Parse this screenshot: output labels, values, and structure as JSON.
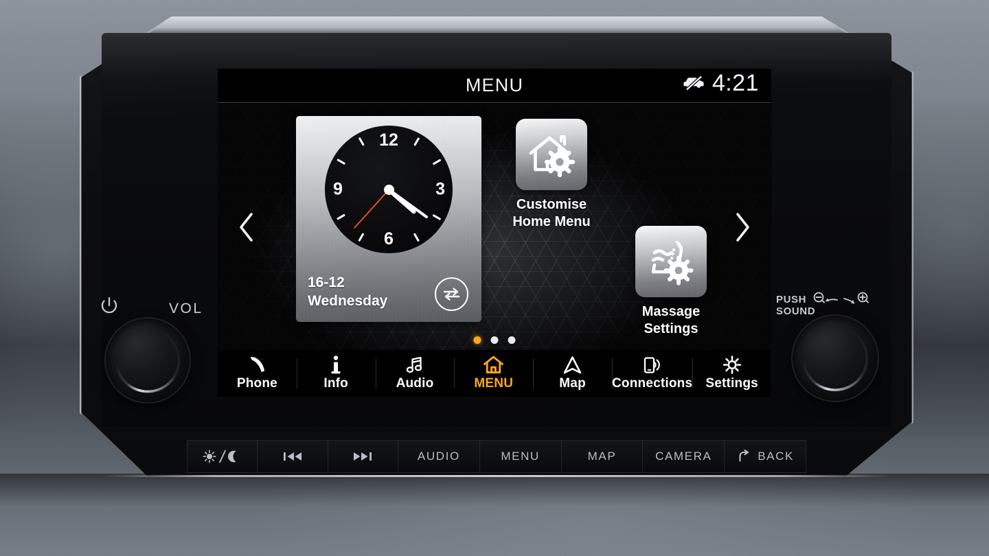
{
  "status_bar": {
    "title": "MENU",
    "time": "4:21",
    "vehicle_icon": "car-off-icon"
  },
  "carousel": {
    "prev_icon": "chevron-left-icon",
    "next_icon": "chevron-right-icon",
    "page_dots": [
      {
        "active": true
      },
      {
        "active": false
      },
      {
        "active": false
      }
    ]
  },
  "clock_widget": {
    "numerals": [
      "12",
      "3",
      "6",
      "9"
    ],
    "date": "16-12",
    "weekday": "Wednesday",
    "swap_icon": "swap-arrows-icon",
    "hour_angle": 131,
    "minute_angle": 126,
    "second_angle": 222
  },
  "tiles": [
    {
      "id": "customise-home-menu",
      "icon": "house-gear-icon",
      "line1": "Customise",
      "line2": "Home Menu"
    },
    {
      "id": "massage-settings",
      "icon": "seat-massage-gear-icon",
      "line1": "Massage",
      "line2": "Settings"
    }
  ],
  "nav_bar": {
    "items": [
      {
        "label": "Phone",
        "icon": "phone-handset-icon",
        "active": false
      },
      {
        "label": "Info",
        "icon": "info-i-icon",
        "active": false
      },
      {
        "label": "Audio",
        "icon": "music-note-icon",
        "active": false
      },
      {
        "label": "MENU",
        "icon": "house-icon",
        "active": true
      },
      {
        "label": "Map",
        "icon": "navigation-arrow-icon",
        "active": false
      },
      {
        "label": "Connections",
        "icon": "phone-signal-icon",
        "active": false
      },
      {
        "label": "Settings",
        "icon": "gear-icon",
        "active": false
      }
    ]
  },
  "hardware": {
    "power_icon": "power-icon",
    "volume_label": "VOL",
    "push_sound_label": "PUSH\nSOUND",
    "push_sound_line1": "PUSH",
    "push_sound_line2": "SOUND",
    "zoom_out_icon": "zoom-out-icon",
    "zoom_in_icon": "zoom-in-icon",
    "buttons": [
      {
        "label": "",
        "icon": "day-night-icon"
      },
      {
        "label": "",
        "icon": "previous-track-icon"
      },
      {
        "label": "",
        "icon": "next-track-icon"
      },
      {
        "label": "AUDIO",
        "icon": ""
      },
      {
        "label": "MENU",
        "icon": ""
      },
      {
        "label": "MAP",
        "icon": ""
      },
      {
        "label": "CAMERA",
        "icon": ""
      },
      {
        "label": "BACK",
        "icon": "back-arrow-icon"
      }
    ]
  },
  "colors": {
    "accent_amber": "#f7a81b",
    "second_hand_orange": "#e8511b",
    "text_white": "#ffffff",
    "screen_black": "#000000"
  }
}
